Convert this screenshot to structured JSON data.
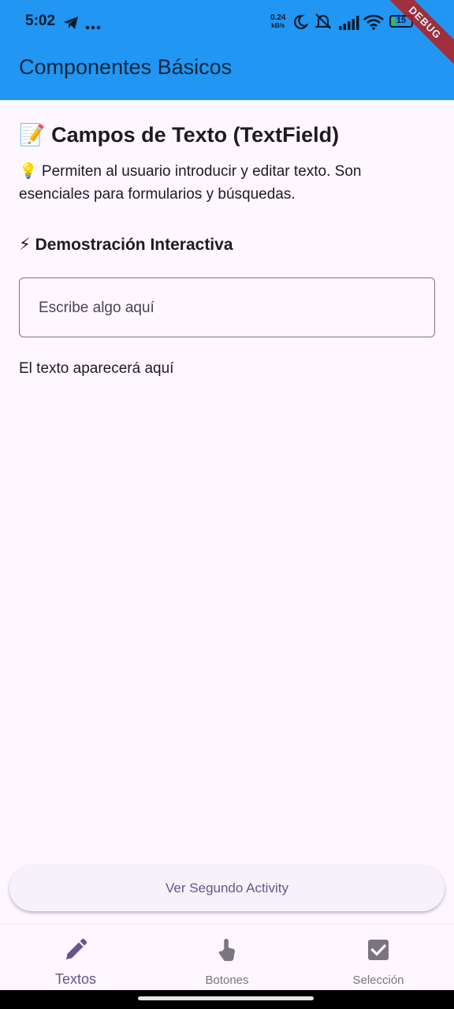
{
  "status_bar": {
    "time": "5:02",
    "net_speed_value": "0.24",
    "net_speed_unit": "kB/s",
    "battery_level": "15",
    "debug_label": "DEBUG"
  },
  "app_bar": {
    "title": "Componentes Básicos"
  },
  "section": {
    "title": "📝 Campos de Texto (TextField)",
    "description": "💡 Permiten al usuario introducir y editar texto. Son esenciales para formularios y búsquedas.",
    "demo_title": "⚡ Demostración Interactiva"
  },
  "text_field": {
    "placeholder": "Escribe algo aquí",
    "value": ""
  },
  "output_text": "El texto aparecerá aquí",
  "action_button": {
    "label": "Ver Segundo Activity"
  },
  "bottom_nav": {
    "items": [
      {
        "label": "Textos",
        "icon": "pencil-icon",
        "selected": true
      },
      {
        "label": "Botones",
        "icon": "touch-icon",
        "selected": false
      },
      {
        "label": "Selección",
        "icon": "checkbox-icon",
        "selected": false
      }
    ]
  },
  "colors": {
    "app_bar": "#2196f3",
    "background": "#fef7ff",
    "accent": "#65558f",
    "inactive": "#7a7580"
  }
}
